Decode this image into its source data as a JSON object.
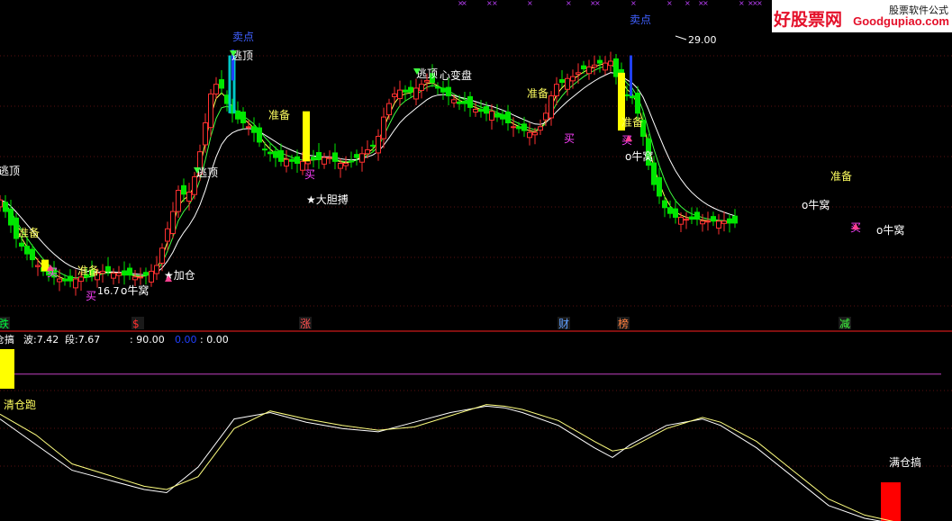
{
  "watermark": {
    "brand": "好股票网",
    "url": "Goodgupiao.com",
    "sub": "股票软件公式"
  },
  "colors": {
    "up": "#ff3030",
    "down": "#00e600",
    "ma1": "#ffff55",
    "ma2": "#40ff40",
    "ma3": "#ffffff",
    "sell": "#4060ff",
    "buy": "#ff40ff",
    "warn": "#ffff60",
    "osc_line": "#ffffaa",
    "level_line": "#c040c0"
  },
  "chart_data": [
    {
      "type": "candlestick",
      "panel": "main",
      "x": [
        0,
        6,
        12,
        18,
        24,
        30,
        36,
        42,
        48,
        54,
        60,
        66,
        72,
        78,
        84,
        90,
        96,
        102,
        108,
        114,
        120,
        126,
        132,
        138,
        144,
        150,
        156,
        162,
        168,
        174,
        180,
        186,
        192,
        198,
        204,
        210,
        216,
        222,
        228,
        234,
        240,
        246,
        252,
        258,
        264,
        270,
        276,
        282,
        288,
        294,
        300,
        306,
        312,
        318,
        324,
        330,
        336,
        342,
        348,
        354,
        360,
        366,
        372,
        378,
        384,
        390,
        396,
        402,
        408,
        414,
        420,
        426,
        432,
        438,
        444,
        450,
        456,
        462,
        468,
        474,
        480,
        486,
        492,
        498,
        504,
        510,
        516,
        522,
        528,
        534,
        540,
        546,
        552,
        558,
        564,
        570,
        576,
        582,
        588,
        594,
        600,
        606,
        612,
        618,
        624,
        630,
        636,
        642,
        648,
        654,
        660,
        666,
        672,
        678,
        684,
        690,
        696,
        702,
        708,
        714,
        720,
        726,
        732,
        738,
        744,
        750,
        756,
        762,
        768,
        774,
        780,
        786,
        792,
        798,
        804,
        810,
        816,
        822,
        828,
        834,
        840,
        846,
        852,
        858,
        864,
        870,
        876,
        882,
        888,
        894,
        900,
        906,
        912,
        918,
        924,
        930,
        936,
        942,
        948,
        954,
        960,
        966,
        972,
        978,
        984,
        990,
        996,
        1002,
        1008,
        1014,
        1020,
        1026,
        1032,
        1038,
        1044
      ],
      "price_values": [
        21.0,
        20.4,
        19.7,
        19.0,
        18.6,
        18.2,
        17.9,
        17.6,
        17.3,
        17.1,
        17.0,
        16.9,
        16.8,
        16.8,
        16.9,
        17.0,
        17.0,
        17.1,
        17.2,
        17.3,
        17.3,
        17.2,
        17.2,
        17.1,
        17.1,
        17.0,
        17.0,
        17.1,
        17.3,
        17.6,
        18.5,
        19.5,
        20.4,
        21.5,
        21.3,
        21.4,
        22.2,
        23.5,
        25.0,
        26.5,
        27.0,
        26.8,
        26.0,
        25.5,
        25.2,
        25.0,
        24.8,
        24.5,
        24.0,
        23.6,
        23.4,
        23.2,
        23.0,
        23.1,
        23.0,
        22.9,
        23.0,
        23.1,
        23.1,
        23.1,
        23.2,
        23.2,
        23.0,
        22.9,
        22.9,
        23.0,
        23.2,
        23.4,
        23.6,
        23.8,
        24.3,
        25.3,
        26.0,
        26.5,
        26.7,
        26.6,
        26.6,
        26.8,
        27.0,
        27.2,
        27.1,
        26.8,
        26.6,
        26.4,
        26.2,
        26.0,
        26.0,
        25.8,
        25.7,
        25.6,
        25.5,
        25.6,
        25.3,
        25.2,
        25.0,
        24.8,
        24.7,
        24.6,
        24.5,
        24.5,
        24.8,
        25.5,
        26.4,
        27.0,
        27.1,
        27.3,
        27.4,
        27.6,
        27.8,
        27.9,
        28.0,
        28.1,
        28.1,
        28.2,
        27.4,
        26.7,
        26.4,
        26.3,
        25.5,
        24.3,
        22.8,
        21.8,
        21.2,
        20.6,
        20.3,
        20.1,
        20.1,
        20.0,
        20.0,
        20.0,
        19.9,
        19.9,
        19.9,
        19.9,
        19.9,
        19.8,
        19.8
      ],
      "price_labels": {
        "low": "16.7",
        "high": "29.00"
      },
      "signals": [
        {
          "x": 0,
          "text": "逃顶"
        },
        {
          "x": 26,
          "text": "准备"
        },
        {
          "x": 57,
          "text": "买"
        },
        {
          "x": 94,
          "text": "准备"
        },
        {
          "x": 100,
          "text": "买"
        },
        {
          "x": 138,
          "text": "牛窝"
        },
        {
          "x": 196,
          "text": "加仓"
        },
        {
          "x": 230,
          "text": "逃顶"
        },
        {
          "x": 268,
          "text": "逃顶"
        },
        {
          "x": 268,
          "text": "卖点"
        },
        {
          "x": 310,
          "text": "准备"
        },
        {
          "x": 345,
          "text": "买"
        },
        {
          "x": 362,
          "text": "大胆搏"
        },
        {
          "x": 475,
          "text": "逃顶"
        },
        {
          "x": 512,
          "text": "心变盘"
        },
        {
          "x": 596,
          "text": "准备"
        },
        {
          "x": 632,
          "text": "买"
        },
        {
          "x": 700,
          "text": "准备"
        },
        {
          "x": 698,
          "text": "买"
        },
        {
          "x": 709,
          "text": "卖点"
        },
        {
          "x": 708,
          "text": "牛窝"
        },
        {
          "x": 932,
          "text": "准备"
        },
        {
          "x": 905,
          "text": "牛窝"
        },
        {
          "x": 952,
          "text": "买"
        },
        {
          "x": 985,
          "text": "牛窝"
        }
      ],
      "event_markers": [
        "跌",
        "$",
        "涨",
        "财",
        "榜",
        "减"
      ]
    },
    {
      "type": "line",
      "panel": "oscillator",
      "header": {
        "name": "仓搞",
        "wave_label": "波:",
        "wave": "7.42",
        "segment_label": "段:",
        "segment": "7.67",
        "v1": ": 90.00",
        "v2": "0.00",
        "v3": ": 0.00"
      },
      "x": [
        0,
        40,
        80,
        120,
        160,
        185,
        220,
        260,
        300,
        340,
        380,
        420,
        460,
        500,
        540,
        560,
        580,
        620,
        660,
        680,
        700,
        740,
        780,
        800,
        840,
        880,
        920,
        960,
        1000
      ],
      "series": [
        {
          "values": [
            62,
            46,
            30,
            24,
            18,
            16,
            32,
            62,
            66,
            60,
            56,
            54,
            60,
            66,
            70,
            69,
            66,
            58,
            44,
            38,
            46,
            58,
            62,
            58,
            44,
            26,
            8,
            0,
            -4
          ]
        },
        {
          "values": [
            65,
            52,
            34,
            27,
            20,
            18,
            26,
            56,
            67,
            62,
            58,
            55,
            57,
            64,
            71,
            70,
            68,
            61,
            48,
            42,
            44,
            56,
            63,
            60,
            48,
            30,
            12,
            2,
            -3
          ]
        }
      ],
      "ylim": [
        0,
        100
      ],
      "level": 90,
      "labels": {
        "top_left": "清仓跑",
        "bottom_right": "满仓搞"
      }
    }
  ]
}
